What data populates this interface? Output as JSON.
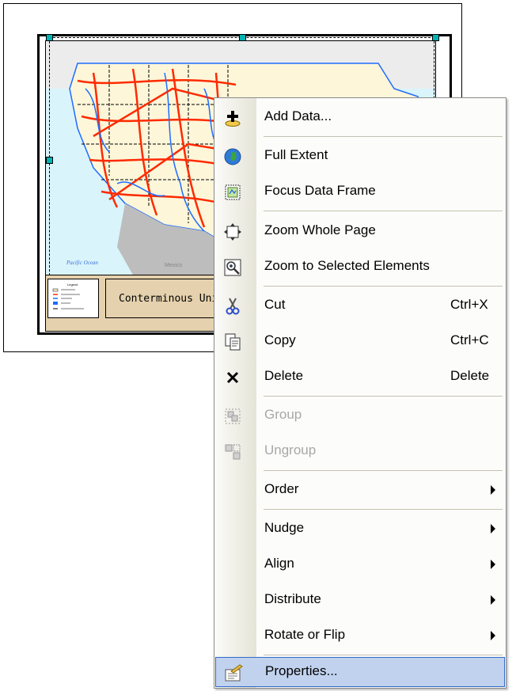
{
  "layout": {
    "map_title": "Conterminous United States",
    "legend_label": "Legend",
    "ocean_label": "Pacific Ocean",
    "country_label": "Mexico"
  },
  "menu": {
    "items": [
      {
        "label": "Add Data...",
        "icon": "add-data-icon"
      },
      {
        "label": "Full Extent",
        "icon": "globe-icon"
      },
      {
        "label": "Focus Data Frame",
        "icon": "focus-frame-icon"
      },
      {
        "label": "Zoom Whole Page",
        "icon": "zoom-whole-page-icon"
      },
      {
        "label": "Zoom to Selected Elements",
        "icon": "zoom-selected-icon"
      },
      {
        "label": "Cut",
        "shortcut": "Ctrl+X",
        "icon": "scissors-icon"
      },
      {
        "label": "Copy",
        "shortcut": "Ctrl+C",
        "icon": "copy-icon"
      },
      {
        "label": "Delete",
        "shortcut": "Delete",
        "icon": "delete-icon"
      },
      {
        "label": "Group",
        "icon": "group-icon",
        "disabled": true
      },
      {
        "label": "Ungroup",
        "icon": "ungroup-icon",
        "disabled": true
      },
      {
        "label": "Order",
        "submenu": true
      },
      {
        "label": "Nudge",
        "submenu": true
      },
      {
        "label": "Align",
        "submenu": true
      },
      {
        "label": "Distribute",
        "submenu": true
      },
      {
        "label": "Rotate or Flip",
        "submenu": true
      },
      {
        "label": "Properties...",
        "icon": "properties-icon",
        "highlighted": true
      }
    ]
  },
  "colors": {
    "highlight_bg": "#c1d2ee",
    "highlight_border": "#316ac5",
    "selection_handle": "#00b4b4",
    "roads": "#ff2a00",
    "rivers": "#1e6cff",
    "land": "#fdf6d9",
    "ocean": "#d9f4fb"
  }
}
